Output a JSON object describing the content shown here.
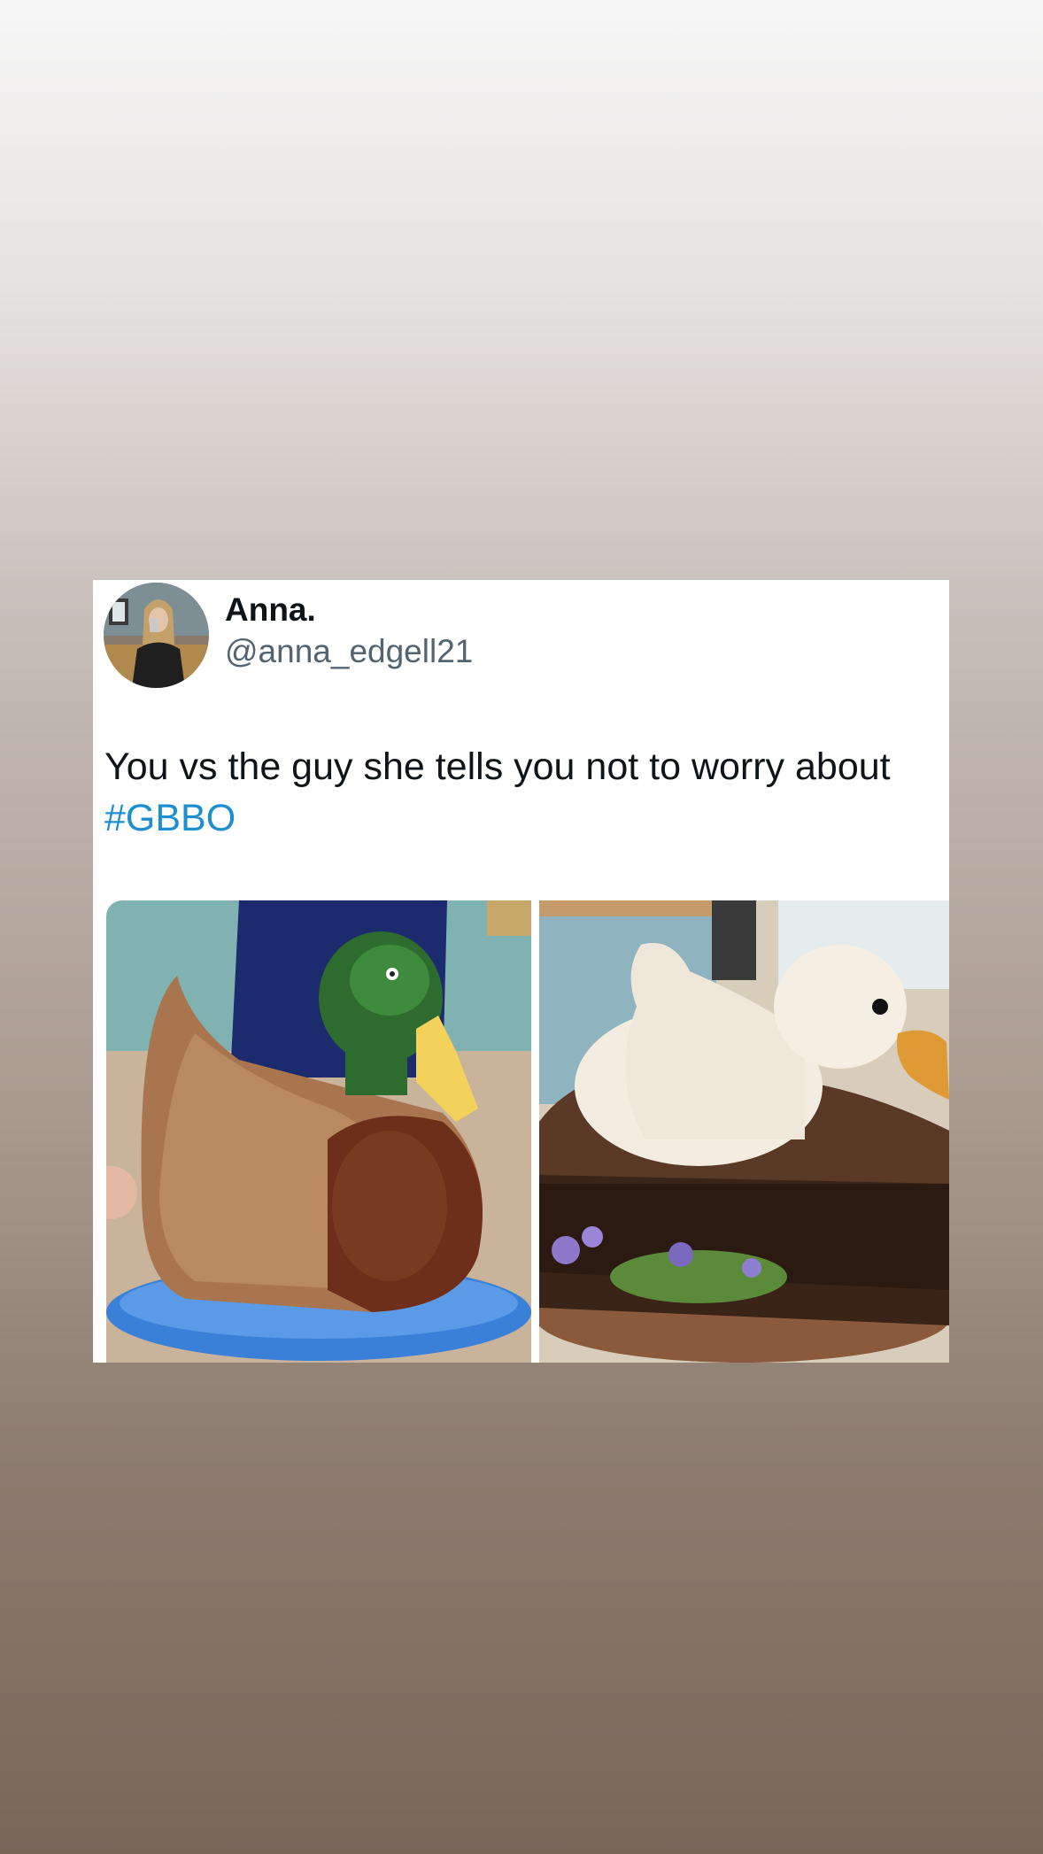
{
  "tweet": {
    "display_name": "Anna.",
    "handle": "@anna_edgell21",
    "text": "You vs the guy she tells you not to worry about",
    "hashtag": "#GBBO"
  },
  "media": [
    {
      "description_icon": "mallard-duck-cake-photo"
    },
    {
      "description_icon": "white-duck-cake-photo"
    }
  ],
  "colors": {
    "hashtag": "#1d8fd1",
    "handle": "#536471",
    "text": "#0f1419",
    "card_background": "#ffffff"
  }
}
